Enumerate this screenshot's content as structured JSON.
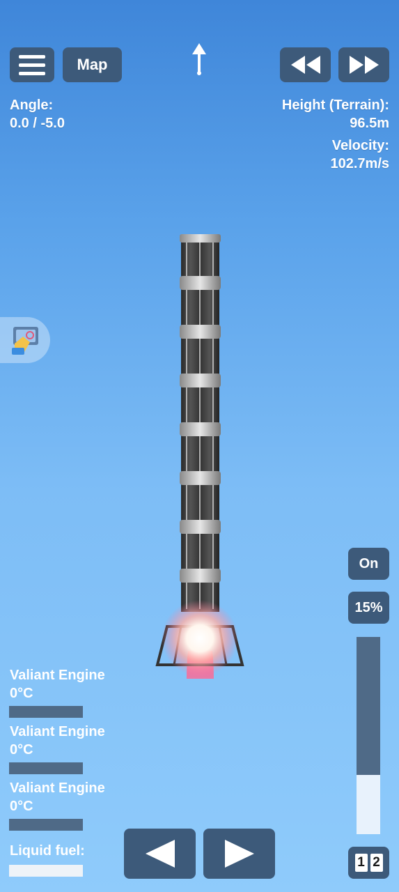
{
  "top_bar": {
    "map_label": "Map"
  },
  "telemetry": {
    "angle_label": "Angle:",
    "angle_value": "0.0 / -5.0",
    "height_label": "Height (Terrain):",
    "height_value": "96.5m",
    "velocity_label": "Velocity:",
    "velocity_value": "102.7m/s"
  },
  "engines": [
    {
      "name": "Valiant Engine",
      "temperature": "0°C"
    },
    {
      "name": "Valiant Engine",
      "temperature": "0°C"
    },
    {
      "name": "Valiant Engine",
      "temperature": "0°C"
    }
  ],
  "fuel": {
    "label": "Liquid fuel:"
  },
  "throttle": {
    "toggle_label": "On",
    "percent_label": "15%",
    "level": 0.3
  },
  "stage": {
    "digit1": "1",
    "digit2": "2"
  },
  "icons": {
    "menu": "hamburger-icon",
    "direction": "up-arrow-icon",
    "rewind": "rewind-icon",
    "fast_forward": "fast-forward-icon",
    "left": "left-arrow-icon",
    "right": "right-arrow-icon"
  },
  "colors": {
    "button_bg": "#3d5a7a",
    "sky_top": "#3f86d9",
    "sky_bottom": "#8fcbfb"
  }
}
